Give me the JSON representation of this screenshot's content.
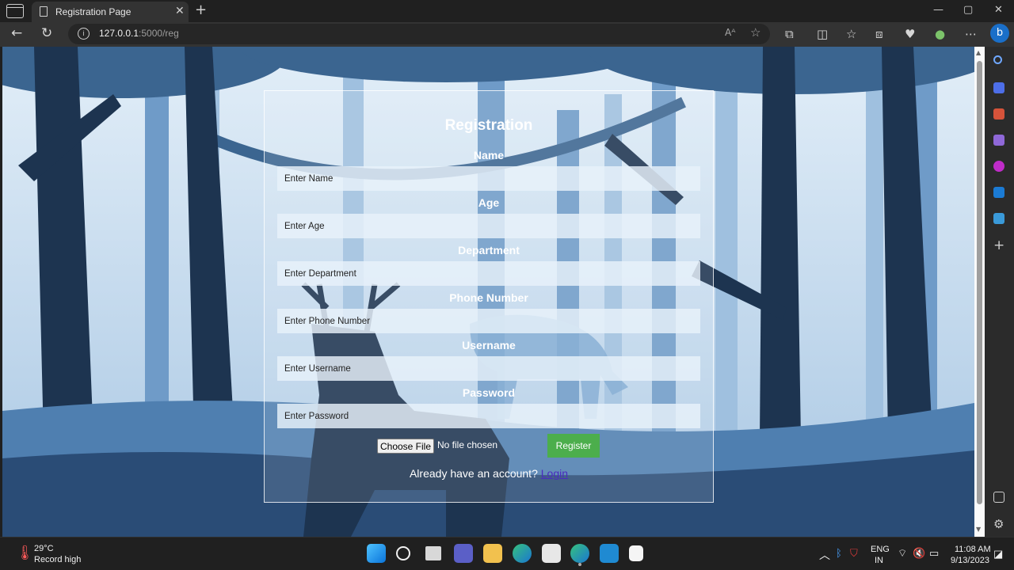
{
  "browser": {
    "tab_title": "Registration Page",
    "url_host": "127.0.0.1",
    "url_path": ":5000/reg"
  },
  "form": {
    "title": "Registration",
    "fields": [
      {
        "label": "Name",
        "placeholder": "Enter Name"
      },
      {
        "label": "Age",
        "placeholder": "Enter Age"
      },
      {
        "label": "Department",
        "placeholder": "Enter Department"
      },
      {
        "label": "Phone Number",
        "placeholder": "Enter Phone Number"
      },
      {
        "label": "Username",
        "placeholder": "Enter Username"
      },
      {
        "label": "Password",
        "placeholder": "Enter Password"
      }
    ],
    "file_button": "Choose File",
    "file_status": "No file chosen",
    "submit": "Register",
    "login_prompt": "Already have an account?",
    "login_link": "Login"
  },
  "taskbar": {
    "weather_temp": "29°C",
    "weather_text": "Record high",
    "lang_1": "ENG",
    "lang_2": "IN",
    "time": "11:08 AM",
    "date": "9/13/2023"
  },
  "colors": {
    "register_button": "#4cae4c",
    "login_link": "#4a2bc0",
    "forest_dark": "#1d3450",
    "sky": "#dcebf7"
  }
}
